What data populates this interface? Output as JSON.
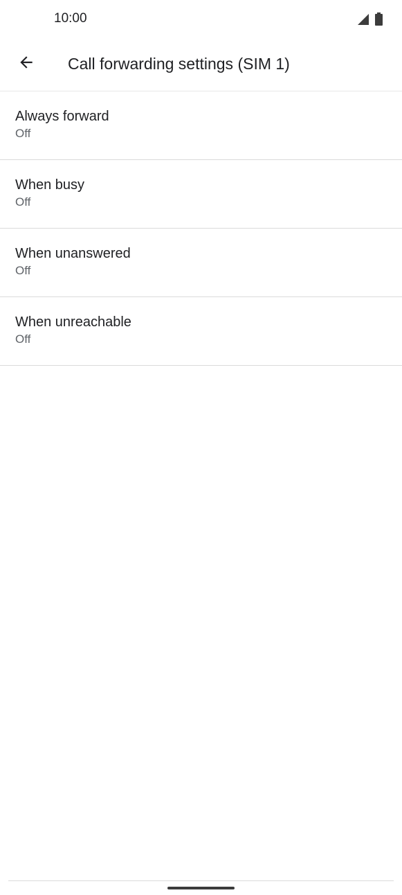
{
  "status_bar": {
    "time": "10:00",
    "icons": [
      "signal-icon",
      "battery-icon"
    ]
  },
  "app_bar": {
    "back_icon": "arrow-back-icon",
    "title": "Call forwarding settings (SIM 1)"
  },
  "items": [
    {
      "title": "Always forward",
      "summary": "Off"
    },
    {
      "title": "When busy",
      "summary": "Off"
    },
    {
      "title": "When unanswered",
      "summary": "Off"
    },
    {
      "title": "When unreachable",
      "summary": "Off"
    }
  ],
  "colors": {
    "text_primary": "#202124",
    "text_secondary": "#5f6368",
    "divider": "#dadada",
    "background": "#ffffff"
  }
}
